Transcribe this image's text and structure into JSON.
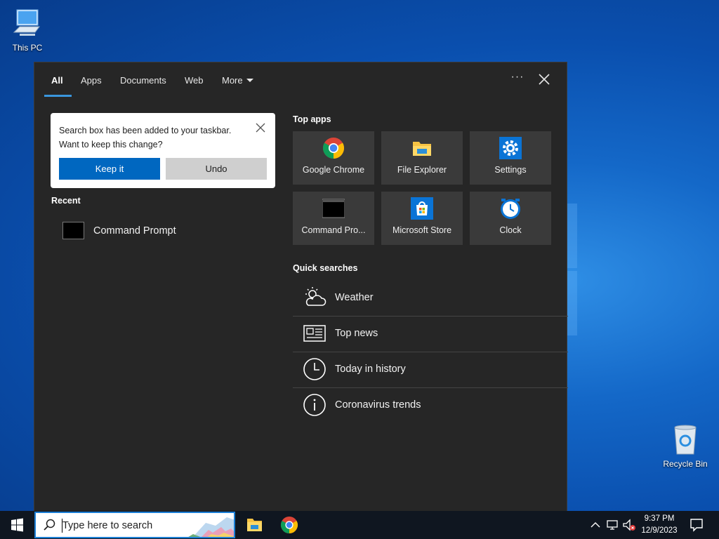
{
  "desktop": {
    "icons": [
      {
        "label": "This PC",
        "icon": "computer-icon"
      },
      {
        "label": "Recycle Bin",
        "icon": "recycle-bin-icon"
      }
    ]
  },
  "search_panel": {
    "tabs": [
      {
        "label": "All",
        "selected": true
      },
      {
        "label": "Apps"
      },
      {
        "label": "Documents"
      },
      {
        "label": "Web"
      },
      {
        "label": "More"
      }
    ],
    "more_menu_icon": "ellipsis-icon",
    "close_icon": "close-icon",
    "notice": {
      "line1": "Search box has been added to your taskbar.",
      "line2": "Want to keep this change?",
      "keep_label": "Keep it",
      "undo_label": "Undo"
    },
    "recent": {
      "title": "Recent",
      "items": [
        {
          "label": "Command Prompt",
          "icon": "command-prompt-icon"
        }
      ]
    },
    "top_apps": {
      "title": "Top apps",
      "apps": [
        {
          "label": "Google Chrome",
          "icon": "chrome-icon"
        },
        {
          "label": "File Explorer",
          "icon": "file-explorer-icon"
        },
        {
          "label": "Settings",
          "icon": "settings-gear-icon"
        },
        {
          "label": "Command Pro...",
          "icon": "command-prompt-icon"
        },
        {
          "label": "Microsoft Store",
          "icon": "store-icon"
        },
        {
          "label": "Clock",
          "icon": "clock-icon"
        }
      ]
    },
    "quick_searches": {
      "title": "Quick searches",
      "items": [
        {
          "label": "Weather",
          "icon": "weather-icon"
        },
        {
          "label": "Top news",
          "icon": "news-icon"
        },
        {
          "label": "Today in history",
          "icon": "history-clock-icon"
        },
        {
          "label": "Coronavirus trends",
          "icon": "info-icon"
        }
      ]
    }
  },
  "taskbar": {
    "search_placeholder": "Type here to search",
    "time": "9:37 PM",
    "date": "12/9/2023"
  },
  "colors": {
    "accent": "#0067c0",
    "panel_bg": "#262626",
    "tile_bg": "#3a3a3a",
    "tab_underline": "#3a96dd"
  }
}
